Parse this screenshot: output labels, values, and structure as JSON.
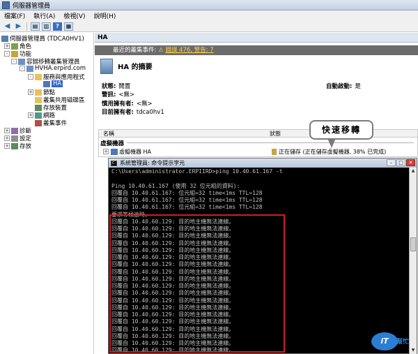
{
  "window": {
    "title": "伺服器管理員"
  },
  "menu": [
    "檔案(F)",
    "執行(A)",
    "檢視(V)",
    "說明(H)"
  ],
  "tree": [
    {
      "label": "伺服器管理員 (TDCA0HV1)",
      "icon": "server-icon",
      "expander": ""
    },
    {
      "label": "角色",
      "icon": "roles-icon",
      "expander": "+"
    },
    {
      "label": "功能",
      "icon": "features-icon",
      "expander": "-"
    },
    {
      "label": "容錯移轉叢集管理員",
      "icon": "cluster-icon",
      "expander": "-"
    },
    {
      "label": "HVHA.erpird.com",
      "icon": "cluster-node-icon",
      "expander": "-"
    },
    {
      "label": "服務與應用程式",
      "icon": "folder-icon",
      "expander": "-"
    },
    {
      "label": "HA",
      "icon": "vm-icon",
      "expander": "",
      "selected": true
    },
    {
      "label": "節點",
      "icon": "folder-icon",
      "expander": "+"
    },
    {
      "label": "叢集共用磁碟區",
      "icon": "folder-icon",
      "expander": ""
    },
    {
      "label": "存放裝置",
      "icon": "storage-icon",
      "expander": ""
    },
    {
      "label": "網路",
      "icon": "network-icon",
      "expander": "+"
    },
    {
      "label": "叢集事件",
      "icon": "event-icon",
      "expander": ""
    },
    {
      "label": "診斷",
      "icon": "diagnostics-icon",
      "expander": "+"
    },
    {
      "label": "設定",
      "icon": "config-icon",
      "expander": "+"
    },
    {
      "label": "存放",
      "icon": "storage-icon",
      "expander": "+"
    }
  ],
  "right": {
    "header": "HA",
    "event_prefix": "最近的叢集事件:",
    "event_link": "錯誤 476, 警告: 7",
    "summary_title": "HA 的摘要",
    "status_label": "狀態:",
    "status_value": "開置",
    "alert_label": "警訊:",
    "alert_value": "<無>",
    "preferred_owner_label": "慣用擁有者:",
    "preferred_owner_value": "<無>",
    "current_owner_label": "目前擁有者:",
    "current_owner_value": "tdca0hv1",
    "autostart_label": "自動啟動:",
    "autostart_value": "是",
    "grid": {
      "col_name": "名稱",
      "col_status": "狀態",
      "group": "虛擬機器",
      "vm_name": "虛擬機器 HA",
      "vm_status": "正在儲存 (正在儲存虛擬機器, 38% 已完成)"
    }
  },
  "callout": "快速移轉",
  "cmd": {
    "title": "系統管理員: 命令提示字元",
    "lines": [
      "C:\\Users\\administrator.ERPIIRD>ping 10.40.61.167 -t",
      "",
      "Ping 10.40.61.167 (使用 32 位元組的資料):",
      "回覆自 10.40.61.167: 位元組=32 time<1ms TTL=128",
      "回覆自 10.40.61.167: 位元組=32 time<1ms TTL=128",
      "回覆自 10.40.61.167: 位元組=32 time<1ms TTL=128",
      "要求等候逾時。",
      "回覆自 10.40.60.129: 目的地主機無法連線。",
      "回覆自 10.40.60.129: 目的地主機無法連線。",
      "回覆自 10.40.60.129: 目的地主機無法連線。",
      "回覆自 10.40.60.129: 目的地主機無法連線。",
      "回覆自 10.40.60.129: 目的地主機無法連線。",
      "回覆自 10.40.60.129: 目的地主機無法連線。",
      "回覆自 10.40.60.129: 目的地主機無法連線。",
      "回覆自 10.40.60.129: 目的地主機無法連線。",
      "回覆自 10.40.60.129: 目的地主機無法連線。",
      "回覆自 10.40.60.129: 目的地主機無法連線。",
      "回覆自 10.40.60.129: 目的地主機無法連線。",
      "回覆自 10.40.60.129: 目的地主機無法連線。",
      "回覆自 10.40.60.129: 目的地主機無法連線。",
      "回覆自 10.40.60.129: 目的地主機無法連線。",
      "回覆自 10.40.60.129: 目的地主機無法連線。",
      "回覆自 10.40.60.129: 目的地主機無法連線。",
      "回覆自 10.40.60.129: 目的地主機無法連線。",
      "回覆自 10.40.60.129: 目的地主機無法連線。",
      "回覆自 10.40.60.129: 目的地主機無法連線。",
      "回覆自 10.40.60.129: 目的地主機無法連線。"
    ]
  },
  "watermark": {
    "logo": "iT",
    "text": "幫忙"
  },
  "colors": {
    "highlight_box": "#d01f1f",
    "selection": "#3366cc",
    "console_bg": "#000000",
    "console_fg": "#c0c0c0"
  }
}
